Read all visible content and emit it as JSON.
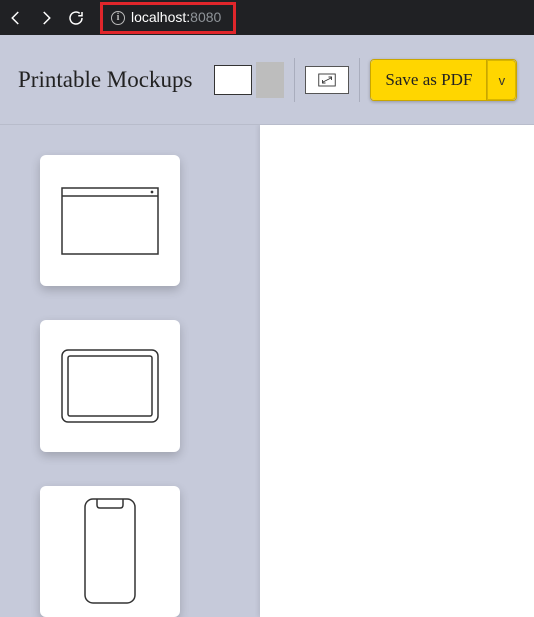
{
  "browser": {
    "url_host": "localhost:",
    "url_port": "8080"
  },
  "app": {
    "title": "Printable Mockups"
  },
  "toolbar": {
    "save_label": "Save as PDF",
    "dropdown_label": "v"
  },
  "sidebar": {
    "items": [
      {
        "id": "browser-window-mockup"
      },
      {
        "id": "tablet-mockup"
      },
      {
        "id": "phone-mockup"
      }
    ]
  }
}
